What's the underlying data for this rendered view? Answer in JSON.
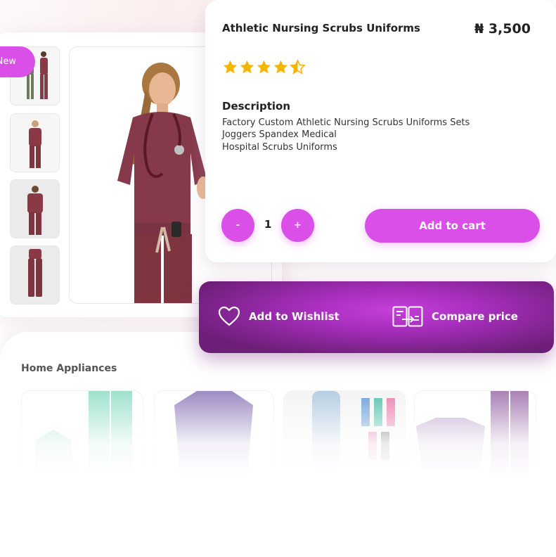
{
  "badge": {
    "label": "New"
  },
  "product": {
    "title": "Athletic Nursing Scrubs Uniforms",
    "price": "₦ 3,500",
    "rating": 4.5,
    "rating_max": 5,
    "description_heading": "Description",
    "description_lines": [
      "Factory Custom Athletic Nursing Scrubs Uniforms Sets",
      "Joggers Spandex Medical",
      "Hospital Scrubs Uniforms"
    ]
  },
  "quantity": {
    "minus_label": "-",
    "value": "1",
    "plus_label": "+"
  },
  "cart": {
    "add_label": "Add to cart"
  },
  "actions": {
    "wishlist_label": "Add to Wishlist",
    "compare_label": "Compare price"
  },
  "section": {
    "title": "Home Appliances"
  },
  "colors": {
    "accent": "#d94fe8",
    "scrub_maroon": "#7f3540",
    "purple_bar": "#8a2a9a",
    "star": "#f4b400"
  },
  "icons": [
    "heart-icon",
    "compare-icon",
    "star-icon"
  ]
}
